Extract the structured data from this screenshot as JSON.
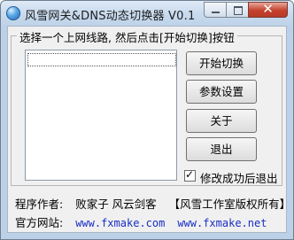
{
  "window": {
    "title": "风雪网关&DNS动态切换器 V0.1",
    "app_icon": "globe-icon",
    "controls": {
      "minimize": "minimize-icon",
      "maximize": "maximize-icon",
      "close_symbol": "✕"
    }
  },
  "group": {
    "label": "选择一个上网线路, 然后点击[开始切换]按钮",
    "route_list": []
  },
  "buttons": {
    "start": "开始切换",
    "settings": "参数设置",
    "about": "关于",
    "exit": "退出"
  },
  "exit_after_success": {
    "label": "修改成功后退出",
    "checked": true
  },
  "footer": {
    "author_label": "程序作者:",
    "author_names": "败家子  风云剑客",
    "copyright": "【风雪工作室版权所有】",
    "site_label": "官方网站:",
    "site1": "www.fxmake.com",
    "site2": "www.fxmake.net"
  },
  "colors": {
    "link": "#1a2ec4",
    "frame": "#bcd1e8",
    "close_button": "#c4422e"
  }
}
